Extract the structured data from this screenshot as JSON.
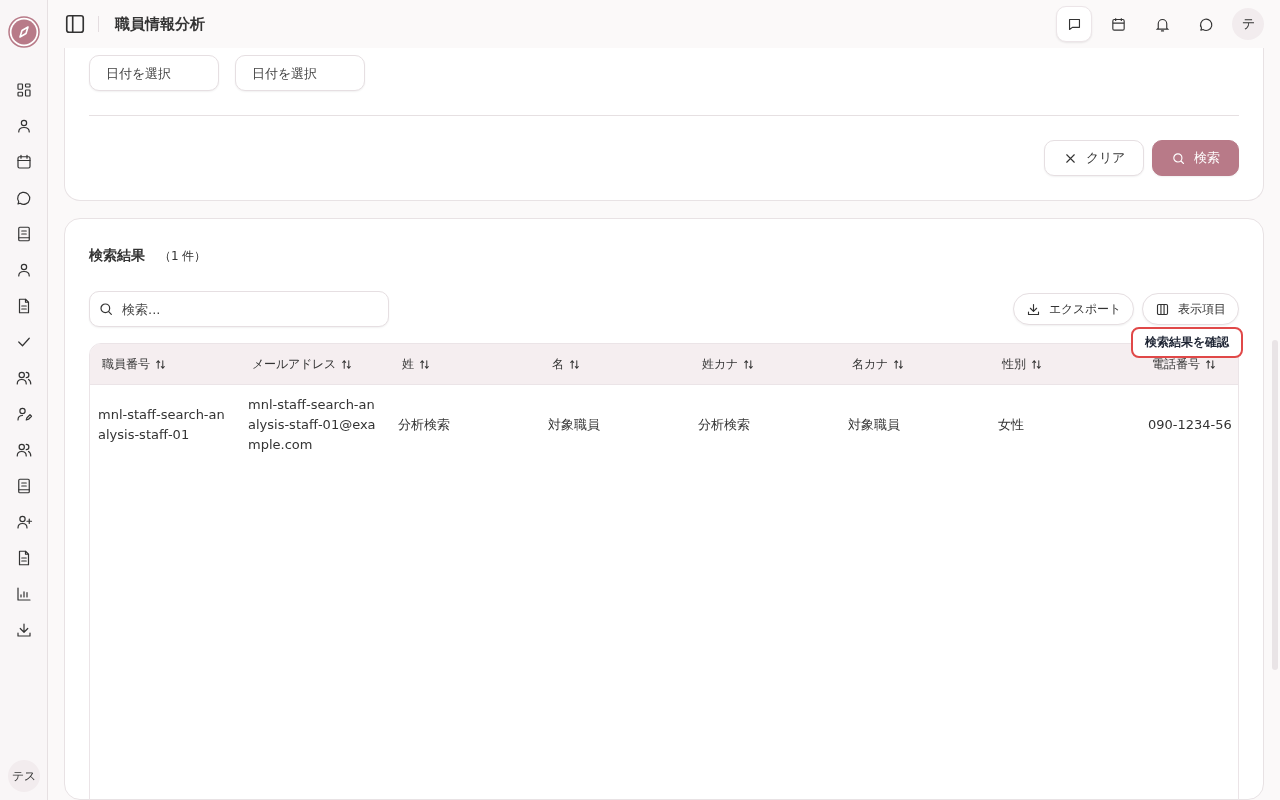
{
  "app": {
    "title": "職員情報分析",
    "avatar": "テ",
    "user": "テス"
  },
  "date_filters": [
    {
      "placeholder": "日付を選択"
    },
    {
      "placeholder": "日付を選択"
    }
  ],
  "actions": {
    "clear": "クリア",
    "search": "検索"
  },
  "results": {
    "title": "検索結果",
    "count": "（1 件）",
    "search": {
      "placeholder": "検索..."
    },
    "export": "エクスポート",
    "columns_button": "表示項目",
    "tooltip": "検索結果を確認",
    "columns": [
      "職員番号",
      "メールアドレス",
      "姓",
      "名",
      "姓カナ",
      "名カナ",
      "性別",
      "電話番号"
    ],
    "rows": [
      {
        "cells": [
          "mnl-staff-search-analysis-staff-01",
          "mnl-staff-search-analysis-staff-01@example.com",
          "分析検索",
          "対象職員",
          "分析検索",
          "対象職員",
          "女性",
          "090-1234-56"
        ]
      }
    ]
  }
}
